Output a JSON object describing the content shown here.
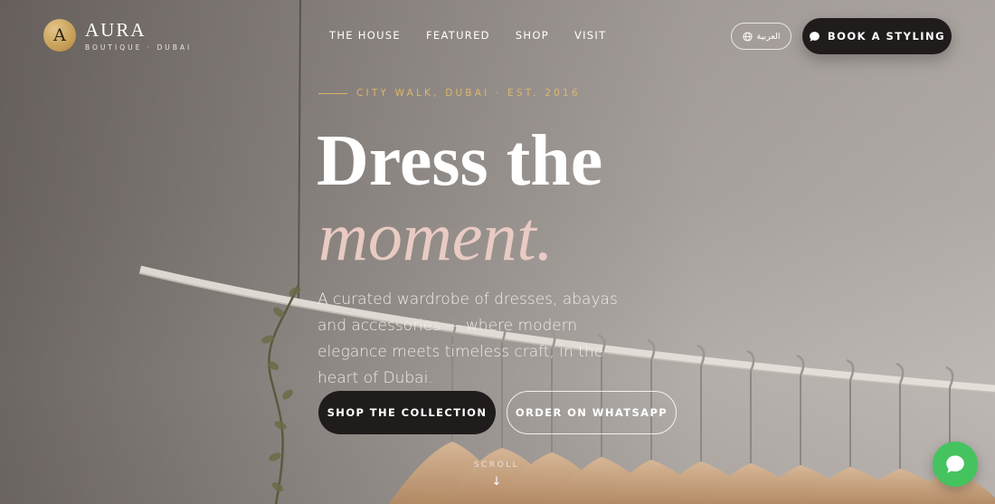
{
  "brand": {
    "monogram": "A",
    "name": "AURA",
    "tagline": "BOUTIQUE · DUBAI",
    "gold": "#c9a25a"
  },
  "nav": {
    "items": [
      {
        "label": "THE HOUSE"
      },
      {
        "label": "FEATURED"
      },
      {
        "label": "SHOP"
      },
      {
        "label": "VISIT"
      }
    ]
  },
  "header": {
    "language_label": "العربية",
    "language_icon": "globe-icon",
    "book_label": "BOOK A STYLING",
    "book_icon": "chat-bubble-icon"
  },
  "hero": {
    "eyebrow": "CITY WALK, DUBAI · EST. 2016",
    "title_line1": "Dress the",
    "title_line2": "moment.",
    "description": "A curated wardrobe of dresses, abayas and accessories — where modern elegance meets timeless craft, in the heart of Dubai.",
    "primary_cta": "SHOP THE COLLECTION",
    "secondary_cta": "ORDER ON WHATSAPP",
    "scroll_label": "SCROLL",
    "scroll_icon": "arrow-down-icon"
  },
  "chat": {
    "icon": "chat-bubble-icon",
    "color": "#45c35f"
  },
  "colors": {
    "accent_gold": "#dcb76c",
    "accent_pink": "#e9cbc4",
    "dark_button": "#1f1c1b"
  }
}
